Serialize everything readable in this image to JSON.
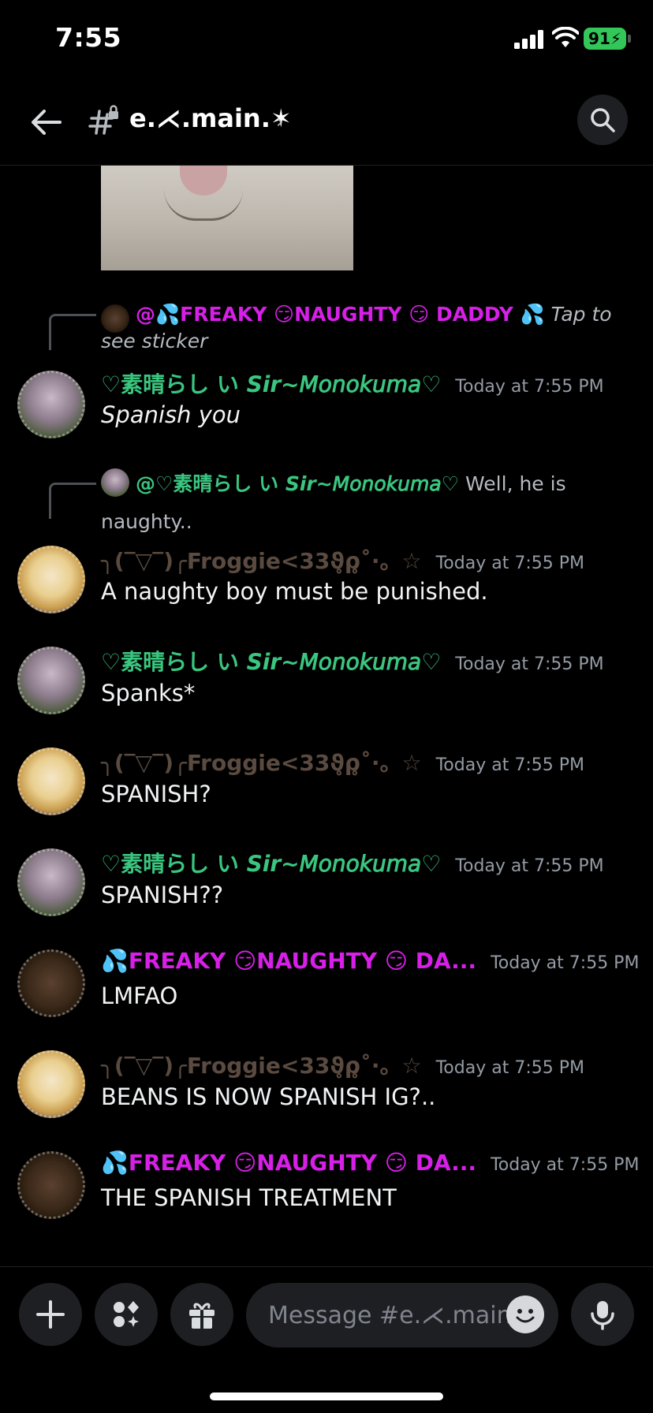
{
  "status": {
    "time": "7:55",
    "battery": "91"
  },
  "header": {
    "channel_name": "e.⋌.main.✶",
    "chevron": "›"
  },
  "messages": [
    {
      "reply_text": "@💦FREAKY 😏NAUGHTY 😏 DADDY 💦",
      "reply_suffix": "Tap to see sticker",
      "username": "♡素晴らし い 𝙎𝙞𝙧~𝘔𝘰𝘯𝘰𝘬𝘶𝘮𝘢♡",
      "timestamp": "Today at 7:55 PM",
      "content": "Spanish you"
    },
    {
      "reply_text": "@♡素晴らし い 𝙎𝙞𝙧~𝘔𝘰𝘯𝘰𝘬𝘶𝘮𝘢♡",
      "reply_suffix": "Well, he is naughty..",
      "username": "╮(‾▽‾)╭Froggie<33ϑ̥ρ̥˚·。☆",
      "timestamp": "Today at 7:55 PM",
      "content": "A naughty boy must be punished."
    },
    {
      "username": "♡素晴らし い 𝙎𝙞𝙧~𝘔𝘰𝘯𝘰𝘬𝘶𝘮𝘢♡",
      "timestamp": "Today at 7:55 PM",
      "content": "Spanks*"
    },
    {
      "username": "╮(‾▽‾)╭Froggie<33ϑ̥ρ̥˚·。☆",
      "timestamp": "Today at 7:55 PM",
      "content": "SPANISH?"
    },
    {
      "username": "♡素晴らし い 𝙎𝙞𝙧~𝘔𝘰𝘯𝘰𝘬𝘶𝘮𝘢♡",
      "timestamp": "Today at 7:55 PM",
      "content": "SPANISH??"
    },
    {
      "username": "💦FREAKY 😏NAUGHTY 😏 DA...",
      "timestamp": "Today at 7:55 PM",
      "content": "LMFAO"
    },
    {
      "username": "╮(‾▽‾)╭Froggie<33ϑ̥ρ̥˚·。☆",
      "timestamp": "Today at 7:55 PM",
      "content": "BEANS IS NOW SPANISH IG?.."
    },
    {
      "username": "💦FREAKY 😏NAUGHTY 😏 DA...",
      "timestamp": "Today at 7:55 PM",
      "content": "THE SPANISH TREATMENT"
    }
  ],
  "composer": {
    "placeholder": "Message #e.⋌.main.✶"
  },
  "colors": {
    "monokuma": "#3ac67f",
    "froggie": "#5a4a3f",
    "daddy": "#d71fe8",
    "timestamp": "#949ba4"
  },
  "icons": [
    "back-arrow-icon",
    "channel-hash-lock-icon",
    "search-icon",
    "plus-icon",
    "apps-icon",
    "gift-icon",
    "emoji-icon",
    "microphone-icon"
  ]
}
